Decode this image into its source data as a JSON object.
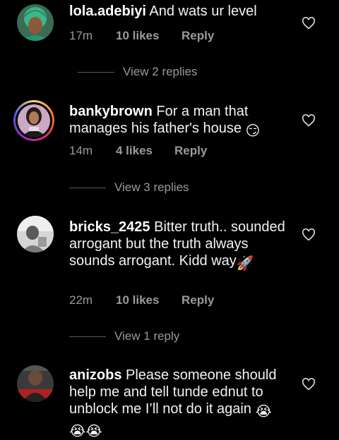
{
  "comments": [
    {
      "username": "lola.adebiyi",
      "text": "And wats ur level",
      "time": "17m",
      "likes": "10 likes",
      "reply": "Reply",
      "view_replies": "View 2 replies",
      "avatar": "avatar-green-headwrap",
      "has_story_ring": false
    },
    {
      "username": "bankybrown",
      "text": "For a man that manages his father's house",
      "emoji": "😏",
      "time": "14m",
      "likes": "4 likes",
      "reply": "Reply",
      "view_replies": "View 3 replies",
      "avatar": "avatar-portrait",
      "has_story_ring": true
    },
    {
      "username": "bricks_2425",
      "text": "Bitter truth.. sounded arrogant but the truth always sounds arrogant. Kidd way",
      "emoji": "🚀",
      "time": "22m",
      "likes": "10 likes",
      "reply": "Reply",
      "view_replies": "View 1 reply",
      "avatar": "avatar-grayscale",
      "has_story_ring": false
    },
    {
      "username": "anizobs",
      "text": "Please someone should help me and tell tunde ednut to unblock me I’ll not do it again",
      "emoji": "😭",
      "emoji_line2": "😭😭",
      "avatar": "avatar-bald-man",
      "has_story_ring": false
    }
  ],
  "colors": {
    "background": "#000000",
    "text": "#f2f2f2",
    "meta": "#9a9a9a",
    "divider": "#5a5a5a"
  },
  "icons": {
    "like": "heart-outline-icon"
  }
}
